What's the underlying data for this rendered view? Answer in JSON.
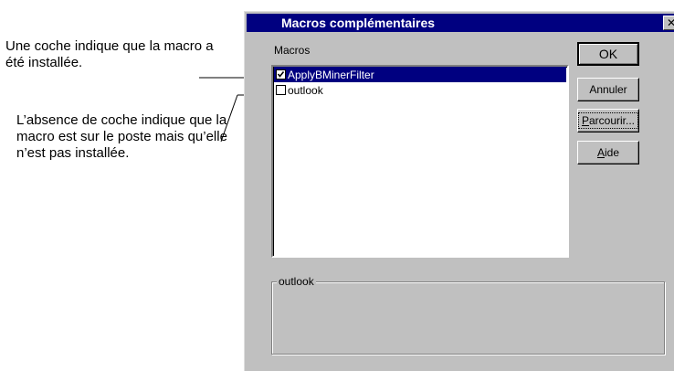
{
  "annotations": {
    "checked_note": "Une coche indique que la macro a été installée.",
    "unchecked_note": "L’absence de coche indique que la macro est sur le poste mais qu’elle n’est pas installée."
  },
  "dialog": {
    "title": "Macros complémentaires",
    "close_glyph": "✕",
    "macros_label": "Macros",
    "macros": [
      {
        "label": "ApplyBMinerFilter",
        "checked": true,
        "selected": true
      },
      {
        "label": "outlook",
        "checked": false,
        "selected": false
      }
    ],
    "buttons": {
      "ok": "OK",
      "cancel": "Annuler",
      "browse_mnemonic": "P",
      "browse_rest": "arcourir...",
      "help_mnemonic": "A",
      "help_rest": "ide"
    },
    "description_group_label": "outlook",
    "description_text": ""
  },
  "colors": {
    "titlebar": "#000080",
    "dialog_face": "#c0c0c0",
    "selection": "#000080"
  }
}
